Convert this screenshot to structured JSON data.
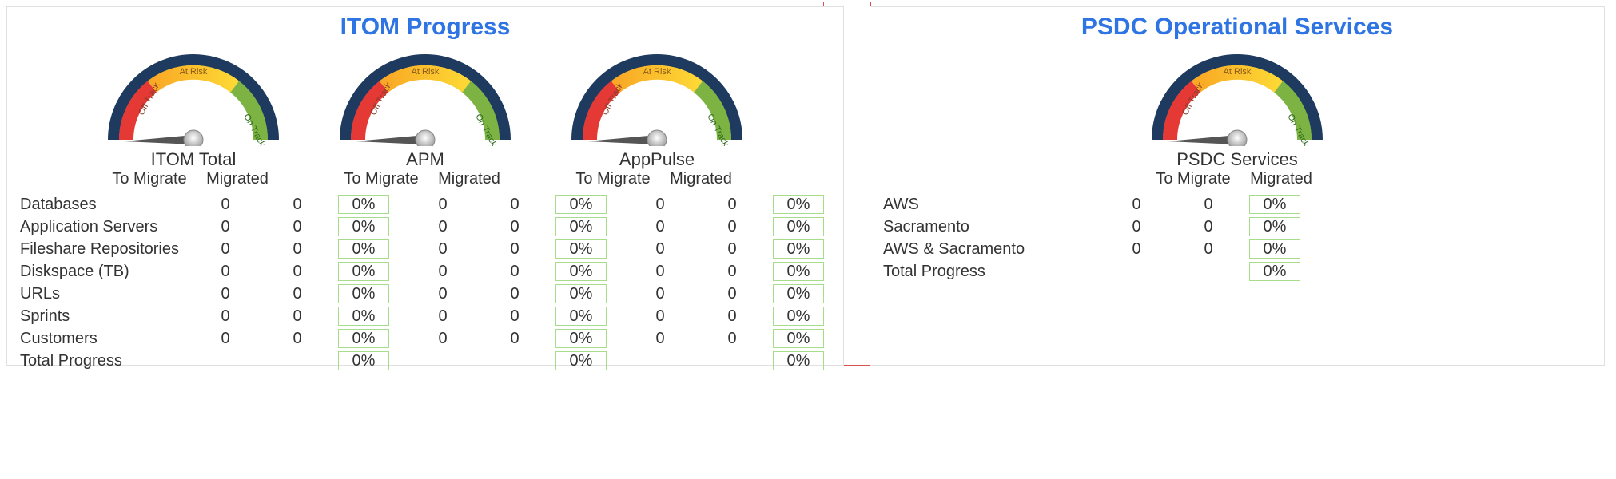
{
  "itom": {
    "title": "ITOM Progress",
    "gauge_labels": {
      "left": "Off Track",
      "mid": "At Risk",
      "right": "On Track"
    },
    "groups": [
      {
        "name": "ITOM Total",
        "to_migrate_label": "To Migrate",
        "migrated_label": "Migrated"
      },
      {
        "name": "APM",
        "to_migrate_label": "To Migrate",
        "migrated_label": "Migrated"
      },
      {
        "name": "AppPulse",
        "to_migrate_label": "To Migrate",
        "migrated_label": "Migrated"
      }
    ],
    "rows": [
      {
        "label": "Databases",
        "vals": [
          [
            0,
            0,
            "0%"
          ],
          [
            0,
            0,
            "0%"
          ],
          [
            0,
            0,
            "0%"
          ]
        ]
      },
      {
        "label": "Application Servers",
        "vals": [
          [
            0,
            0,
            "0%"
          ],
          [
            0,
            0,
            "0%"
          ],
          [
            0,
            0,
            "0%"
          ]
        ]
      },
      {
        "label": "Fileshare Repositories",
        "vals": [
          [
            0,
            0,
            "0%"
          ],
          [
            0,
            0,
            "0%"
          ],
          [
            0,
            0,
            "0%"
          ]
        ]
      },
      {
        "label": "Diskspace (TB)",
        "vals": [
          [
            0,
            0,
            "0%"
          ],
          [
            0,
            0,
            "0%"
          ],
          [
            0,
            0,
            "0%"
          ]
        ]
      },
      {
        "label": "URLs",
        "vals": [
          [
            0,
            0,
            "0%"
          ],
          [
            0,
            0,
            "0%"
          ],
          [
            0,
            0,
            "0%"
          ]
        ]
      },
      {
        "label": "Sprints",
        "vals": [
          [
            0,
            0,
            "0%"
          ],
          [
            0,
            0,
            "0%"
          ],
          [
            0,
            0,
            "0%"
          ]
        ]
      },
      {
        "label": "Customers",
        "vals": [
          [
            0,
            0,
            "0%"
          ],
          [
            0,
            0,
            "0%"
          ],
          [
            0,
            0,
            "0%"
          ]
        ]
      },
      {
        "label": "Total Progress",
        "vals": [
          [
            null,
            null,
            "0%"
          ],
          [
            null,
            null,
            "0%"
          ],
          [
            null,
            null,
            "0%"
          ]
        ]
      }
    ]
  },
  "psdc": {
    "title": "PSDC Operational Services",
    "gauge_labels": {
      "left": "Off Track",
      "mid": "At Risk",
      "right": "On Track"
    },
    "groups": [
      {
        "name": "PSDC Services",
        "to_migrate_label": "To Migrate",
        "migrated_label": "Migrated"
      }
    ],
    "rows": [
      {
        "label": "AWS",
        "vals": [
          [
            0,
            0,
            "0%"
          ]
        ]
      },
      {
        "label": "Sacramento",
        "vals": [
          [
            0,
            0,
            "0%"
          ]
        ]
      },
      {
        "label": "AWS & Sacramento",
        "vals": [
          [
            0,
            0,
            "0%"
          ]
        ]
      },
      {
        "label": "Total Progress",
        "vals": [
          [
            null,
            null,
            "0%"
          ]
        ]
      }
    ]
  },
  "chart_data": [
    {
      "type": "table",
      "title": "ITOM Progress",
      "columns_per_group": [
        "To Migrate",
        "Migrated",
        "%"
      ],
      "groups": [
        "ITOM Total",
        "APM",
        "AppPulse"
      ],
      "rows": [
        "Databases",
        "Application Servers",
        "Fileshare Repositories",
        "Diskspace (TB)",
        "URLs",
        "Sprints",
        "Customers",
        "Total Progress"
      ],
      "values": {
        "ITOM Total": [
          [
            0,
            0,
            "0%"
          ],
          [
            0,
            0,
            "0%"
          ],
          [
            0,
            0,
            "0%"
          ],
          [
            0,
            0,
            "0%"
          ],
          [
            0,
            0,
            "0%"
          ],
          [
            0,
            0,
            "0%"
          ],
          [
            0,
            0,
            "0%"
          ],
          [
            null,
            null,
            "0%"
          ]
        ],
        "APM": [
          [
            0,
            0,
            "0%"
          ],
          [
            0,
            0,
            "0%"
          ],
          [
            0,
            0,
            "0%"
          ],
          [
            0,
            0,
            "0%"
          ],
          [
            0,
            0,
            "0%"
          ],
          [
            0,
            0,
            "0%"
          ],
          [
            0,
            0,
            "0%"
          ],
          [
            null,
            null,
            "0%"
          ]
        ],
        "AppPulse": [
          [
            0,
            0,
            "0%"
          ],
          [
            0,
            0,
            "0%"
          ],
          [
            0,
            0,
            "0%"
          ],
          [
            0,
            0,
            "0%"
          ],
          [
            0,
            0,
            "0%"
          ],
          [
            0,
            0,
            "0%"
          ],
          [
            0,
            0,
            "0%"
          ],
          [
            null,
            null,
            "0%"
          ]
        ]
      },
      "gauges": [
        {
          "name": "ITOM Total",
          "value": 0,
          "zones": [
            "Off Track",
            "At Risk",
            "On Track"
          ]
        },
        {
          "name": "APM",
          "value": 0,
          "zones": [
            "Off Track",
            "At Risk",
            "On Track"
          ]
        },
        {
          "name": "AppPulse",
          "value": 0,
          "zones": [
            "Off Track",
            "At Risk",
            "On Track"
          ]
        }
      ]
    },
    {
      "type": "table",
      "title": "PSDC Operational Services",
      "columns_per_group": [
        "To Migrate",
        "Migrated",
        "%"
      ],
      "groups": [
        "PSDC Services"
      ],
      "rows": [
        "AWS",
        "Sacramento",
        "AWS & Sacramento",
        "Total Progress"
      ],
      "values": {
        "PSDC Services": [
          [
            0,
            0,
            "0%"
          ],
          [
            0,
            0,
            "0%"
          ],
          [
            0,
            0,
            "0%"
          ],
          [
            null,
            null,
            "0%"
          ]
        ]
      },
      "gauges": [
        {
          "name": "PSDC Services",
          "value": 0,
          "zones": [
            "Off Track",
            "At Risk",
            "On Track"
          ]
        }
      ]
    }
  ]
}
